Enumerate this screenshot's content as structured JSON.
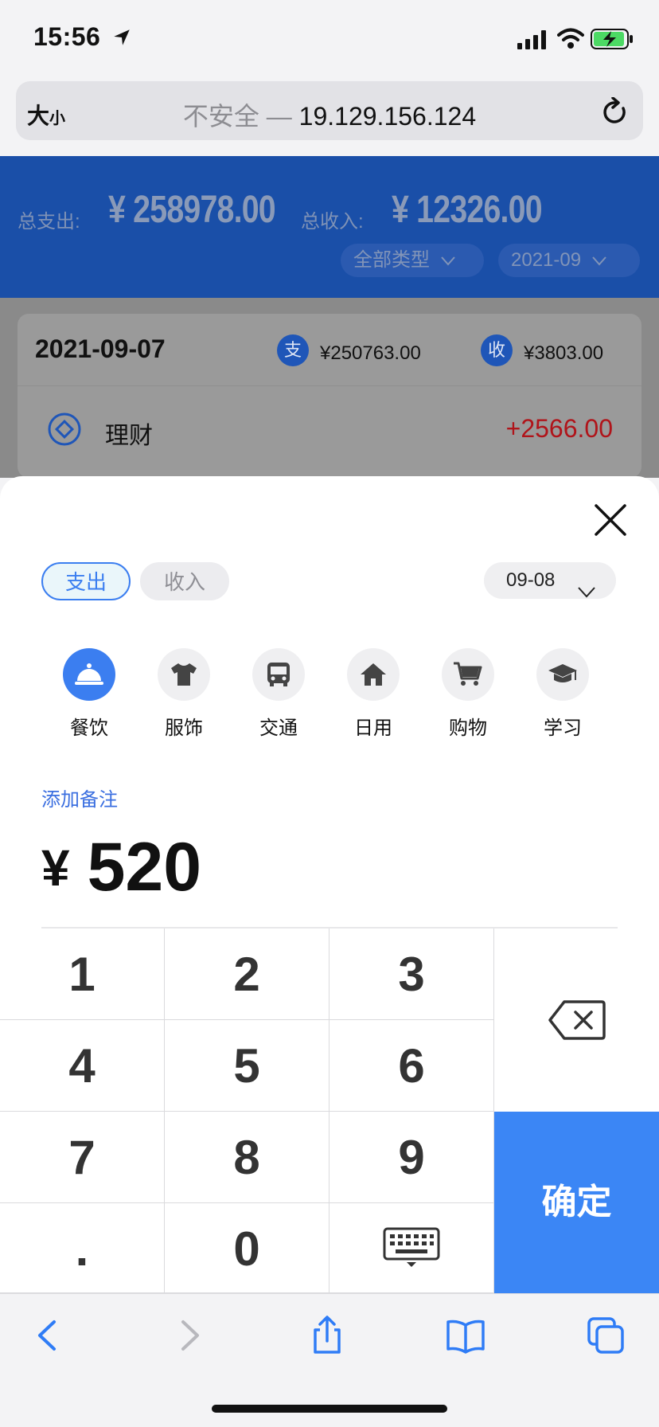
{
  "status_bar": {
    "time": "15:56"
  },
  "browser": {
    "text_size_big": "大",
    "text_size_small": "小",
    "url_insecure": "不安全 —",
    "url_host": "19.129.156.124"
  },
  "summary": {
    "expense_label": "总支出:",
    "expense_value": "¥ 258978.00",
    "income_label": "总收入:",
    "income_value": "¥ 12326.00",
    "type_filter": "全部类型",
    "month_filter": "2021-09"
  },
  "day_group": {
    "date": "2021-09-07",
    "expense_badge": "支",
    "expense_total": "¥250763.00",
    "income_badge": "收",
    "income_total": "¥3803.00",
    "items": [
      {
        "name": "理财",
        "amount": "+2566.00"
      }
    ]
  },
  "sheet": {
    "tabs": {
      "expense": "支出",
      "income": "收入"
    },
    "date": "09-08",
    "categories": [
      {
        "label": "餐饮",
        "icon": "food-cover-icon",
        "active": true
      },
      {
        "label": "服饰",
        "icon": "shirt-icon"
      },
      {
        "label": "交通",
        "icon": "bus-icon"
      },
      {
        "label": "日用",
        "icon": "home-icon"
      },
      {
        "label": "购物",
        "icon": "cart-icon"
      },
      {
        "label": "学习",
        "icon": "graduation-cap-icon"
      }
    ],
    "add_note": "添加备注",
    "currency": "¥",
    "amount": "520"
  },
  "keypad": {
    "keys": [
      "1",
      "2",
      "3",
      "4",
      "5",
      "6",
      "7",
      "8",
      "9",
      ".",
      "0"
    ],
    "confirm": "确定"
  },
  "colors": {
    "accent": "#3b86f5",
    "header_blue": "#1a4fa8",
    "income_red": "#b0141a"
  }
}
